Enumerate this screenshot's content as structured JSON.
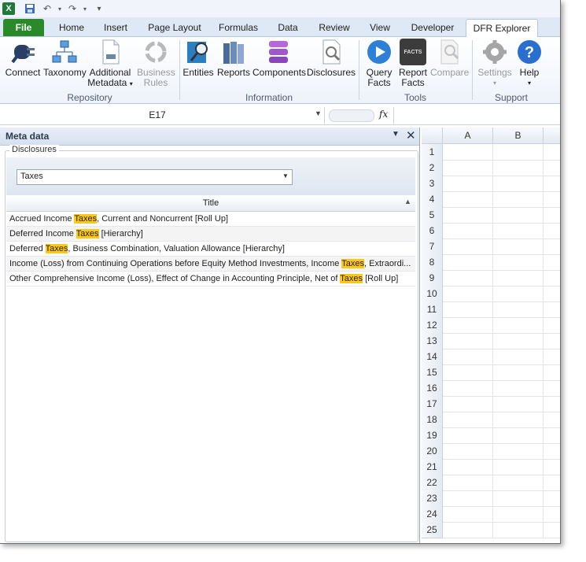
{
  "quick_access": {
    "undo_icon": "undo-icon",
    "redo_icon": "redo-icon",
    "save_icon": "save-icon"
  },
  "tabs": [
    {
      "label": "File"
    },
    {
      "label": "Home"
    },
    {
      "label": "Insert"
    },
    {
      "label": "Page Layout"
    },
    {
      "label": "Formulas"
    },
    {
      "label": "Data"
    },
    {
      "label": "Review"
    },
    {
      "label": "View"
    },
    {
      "label": "Developer"
    },
    {
      "label": "DFR Explorer"
    }
  ],
  "ribbon": {
    "repository": {
      "label": "Repository",
      "connect": "Connect",
      "taxonomy": "Taxonomy",
      "additional_metadata_1": "Additional",
      "additional_metadata_2": "Metadata",
      "business_rules_1": "Business",
      "business_rules_2": "Rules"
    },
    "information": {
      "label": "Information",
      "entities": "Entities",
      "reports": "Reports",
      "components": "Components",
      "disclosures": "Disclosures"
    },
    "tools": {
      "label": "Tools",
      "query_facts_1": "Query",
      "query_facts_2": "Facts",
      "report_facts_1": "Report",
      "report_facts_2": "Facts",
      "report_icon_text": "FACTS",
      "compare": "Compare"
    },
    "support": {
      "label": "Support",
      "settings": "Settings",
      "help": "Help"
    }
  },
  "formula_bar": {
    "name_box": "E17",
    "fx": "fx",
    "formula": ""
  },
  "meta_panel": {
    "title": "Meta data",
    "group_label": "Disclosures",
    "selected_filter": "Taxes",
    "column_header": "Title",
    "rows": [
      {
        "pre": "Accrued Income ",
        "hl": "Taxes",
        "post": ", Current and Noncurrent [Roll Up]"
      },
      {
        "pre": "Deferred Income ",
        "hl": "Taxes",
        "post": " [Hierarchy]"
      },
      {
        "pre": "Deferred ",
        "hl": "Taxes",
        "post": ", Business Combination, Valuation Allowance [Hierarchy]"
      },
      {
        "pre": "Income (Loss) from Continuing Operations before Equity Method Investments, Income ",
        "hl": "Taxes",
        "post": ", Extraordi..."
      },
      {
        "pre": "Other Comprehensive Income (Loss), Effect of Change in Accounting Principle, Net of ",
        "hl": "Taxes",
        "post": " [Roll Up]"
      }
    ]
  },
  "sheet": {
    "columns": [
      "A",
      "B"
    ],
    "rows": [
      "1",
      "2",
      "3",
      "4",
      "5",
      "6",
      "7",
      "8",
      "9",
      "10",
      "11",
      "12",
      "13",
      "14",
      "15",
      "16",
      "17",
      "18",
      "19",
      "20",
      "21",
      "22",
      "23",
      "24",
      "25"
    ]
  }
}
